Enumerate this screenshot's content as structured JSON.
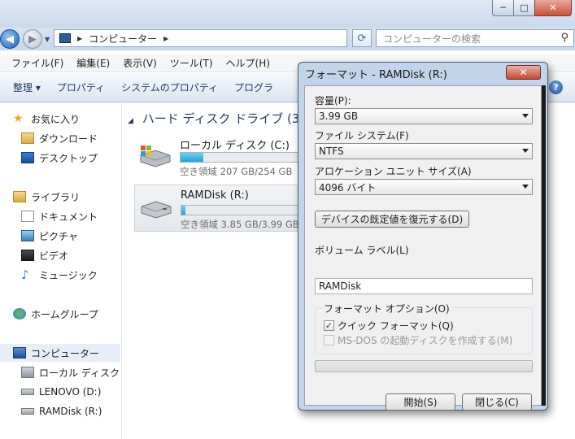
{
  "window": {
    "caption_min": "─",
    "caption_max": "□",
    "caption_close": "✕"
  },
  "address": {
    "location": "コンピューター"
  },
  "search": {
    "placeholder": "コンピューターの検索"
  },
  "menu": [
    "ファイル(F)",
    "編集(E)",
    "表示(V)",
    "ツール(T)",
    "ヘルプ(H)"
  ],
  "toolbar": [
    "整理 ▾",
    "プロパティ",
    "システムのプロパティ",
    "プログラ"
  ],
  "sidebar": {
    "favorites": {
      "label": "お気に入り",
      "items": [
        "ダウンロード",
        "デスクトップ"
      ]
    },
    "libraries": {
      "label": "ライブラリ",
      "items": [
        "ドキュメント",
        "ピクチャ",
        "ビデオ",
        "ミュージック"
      ]
    },
    "homegroup": "ホームグループ",
    "computer": {
      "label": "コンピューター",
      "items": [
        "ローカル ディスク",
        "LENOVO (D:)",
        "RAMDisk (R:)"
      ]
    }
  },
  "content": {
    "group_header": "ハード ディスク ドライブ (3",
    "drives": [
      {
        "name": "ローカル ディスク (C:)",
        "free": "空き領域 207 GB/254 GB",
        "used_fraction": 0.19
      },
      {
        "name": "RAMDisk (R:)",
        "free": "空き領域 3.85 GB/3.99 GB",
        "used_fraction": 0.035
      }
    ]
  },
  "dialog": {
    "title": "フォーマット - RAMDisk (R:)",
    "close": "✕",
    "capacity_label": "容量(P):",
    "capacity_value": "3.99 GB",
    "fs_label": "ファイル システム(F)",
    "fs_value": "NTFS",
    "alloc_label": "アロケーション ユニット サイズ(A)",
    "alloc_value": "4096 バイト",
    "restore_defaults": "デバイスの既定値を復元する(D)",
    "volume_label": "ボリューム ラベル(L)",
    "volume_value": "RAMDisk",
    "options_legend": "フォーマット オプション(O)",
    "quick_format": "クイック フォーマット(Q)",
    "quick_format_checked": true,
    "msdos_boot": "MS-DOS の起動ディスクを作成する(M)",
    "start": "開始(S)",
    "close_button": "閉じる(C)"
  },
  "colors": {
    "accent": "#26a0da",
    "dialog_frame": "#c2d4ea",
    "close_red": "#c8503a"
  }
}
